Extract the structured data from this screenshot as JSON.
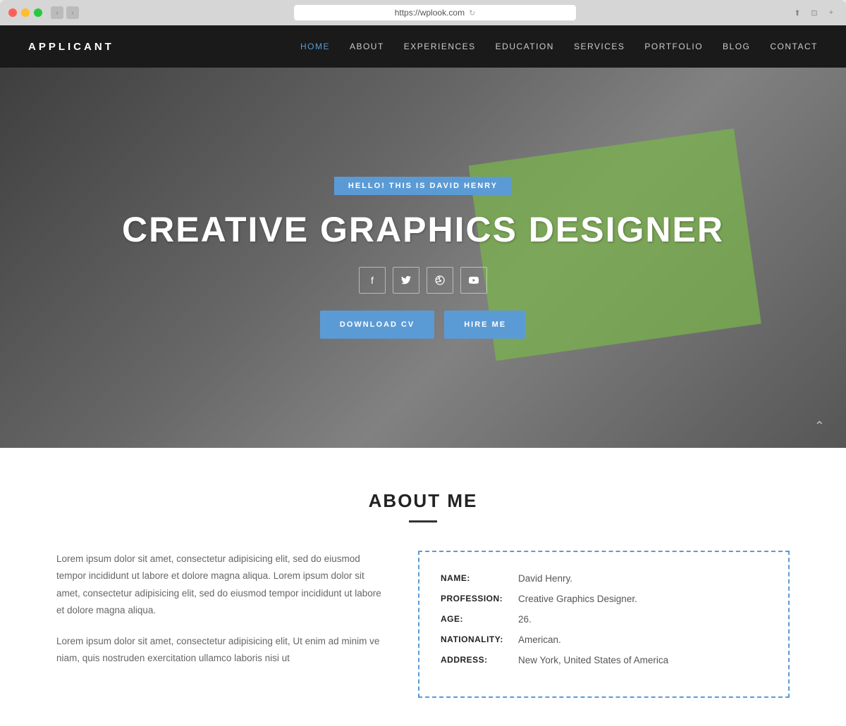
{
  "browser": {
    "url": "https://wplook.com",
    "close_btn": "●",
    "minimize_btn": "●",
    "maximize_btn": "●"
  },
  "nav": {
    "logo": "APPLICANT",
    "links": [
      {
        "label": "HOME",
        "active": true
      },
      {
        "label": "ABOUT",
        "active": false
      },
      {
        "label": "EXPERIENCES",
        "active": false
      },
      {
        "label": "EDUCATION",
        "active": false
      },
      {
        "label": "SERVICES",
        "active": false
      },
      {
        "label": "PORTFOLIO",
        "active": false
      },
      {
        "label": "BLOG",
        "active": false
      },
      {
        "label": "CONTACT",
        "active": false
      }
    ]
  },
  "hero": {
    "tagline": "HELLO! THIS IS DAVID HENRY",
    "title": "CREATIVE GRAPHICS DESIGNER",
    "social_icons": [
      "f",
      "t",
      "◎",
      "▶"
    ],
    "btn_cv": "DOWNLOAD CV",
    "btn_hire": "HIRE ME"
  },
  "about": {
    "section_title": "ABOUT ME",
    "para1": "Lorem ipsum dolor sit amet, consectetur adipisicing elit, sed do eiusmod tempor incididunt ut labore et dolore magna aliqua. Lorem ipsum dolor sit amet, consectetur adipisicing elit, sed do eiusmod tempor incididunt ut labore et dolore magna aliqua.",
    "para2": "Lorem ipsum dolor sit amet, consectetur adipisicing elit, Ut enim ad minim ve niam, quis nostruden exercitation ullamco laboris nisi ut",
    "info": {
      "name_label": "NAME:",
      "name_value": "David Henry.",
      "profession_label": "PROFESSION:",
      "profession_value": "Creative Graphics Designer.",
      "age_label": "AGE:",
      "age_value": "26.",
      "nationality_label": "NATIONALITY:",
      "nationality_value": "American.",
      "address_label": "ADDRESS:",
      "address_value": "New York, United States of America"
    }
  }
}
